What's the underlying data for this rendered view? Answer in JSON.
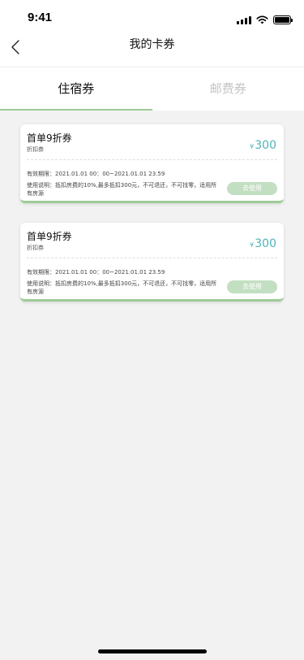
{
  "status_bar": {
    "time": "9:41"
  },
  "nav": {
    "title": "我的卡券"
  },
  "tabs": [
    {
      "label": "住宿券",
      "active": true
    },
    {
      "label": "邮费券",
      "active": false
    }
  ],
  "coupons": [
    {
      "title": "首单9折券",
      "subtitle": "折扣券",
      "currency": "¥",
      "amount": "300",
      "validity": "有效期限：2021.01.01 00：00~2021.01.01 23.59",
      "usage": "使用说明：抵扣房费的10%,最多抵扣300元，不可退还，不可找零，适用所有房源",
      "button_label": "去使用"
    },
    {
      "title": "首单9折券",
      "subtitle": "折扣券",
      "currency": "¥",
      "amount": "300",
      "validity": "有效期限：2021.01.01 00：00~2021.01.01 23.59",
      "usage": "使用说明：抵扣房费的10%,最多抵扣300元，不可退还，不可找零，适用所有房源",
      "button_label": "去使用"
    }
  ],
  "colors": {
    "accent_green": "#9ecb97",
    "button_green": "#c3dfc2",
    "amount_teal": "#4fb4b8",
    "background": "#f2f2f2"
  },
  "icons": {
    "back": "chevron-left-icon",
    "signal": "cellular-signal-icon",
    "wifi": "wifi-icon",
    "battery": "battery-icon"
  }
}
